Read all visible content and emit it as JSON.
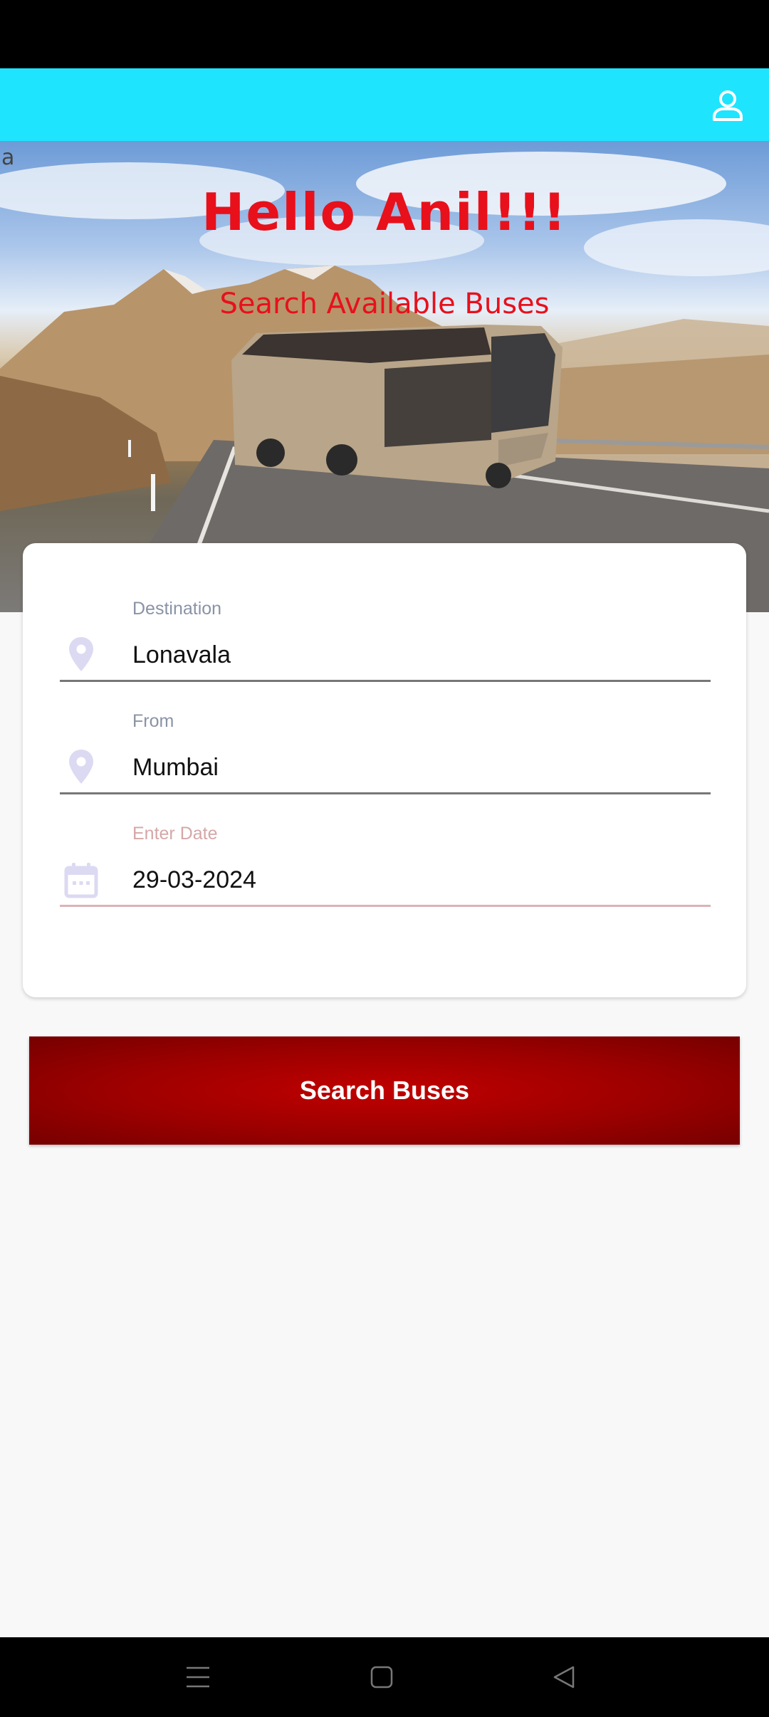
{
  "hero": {
    "corner_text": "a",
    "title": "Hello Anil!!!",
    "subtitle": "Search Available Buses"
  },
  "icons": {
    "profile": "profile-icon",
    "destination": "location-pin-icon",
    "from": "location-pin-icon",
    "date": "calendar-icon",
    "nav_menu": "menu-icon",
    "nav_home": "home-icon",
    "nav_back": "back-icon"
  },
  "form": {
    "destination": {
      "label": "Destination",
      "value": "Lonavala"
    },
    "from": {
      "label": "From",
      "value": "Mumbai"
    },
    "date": {
      "label": "Enter Date",
      "value": "29-03-2024"
    }
  },
  "search_button": {
    "label": "Search Buses"
  },
  "colors": {
    "app_bar": "#1ee4fe",
    "hero_text": "#e8101b",
    "button": "#b00000",
    "date_accent": "#dcb3b6"
  }
}
